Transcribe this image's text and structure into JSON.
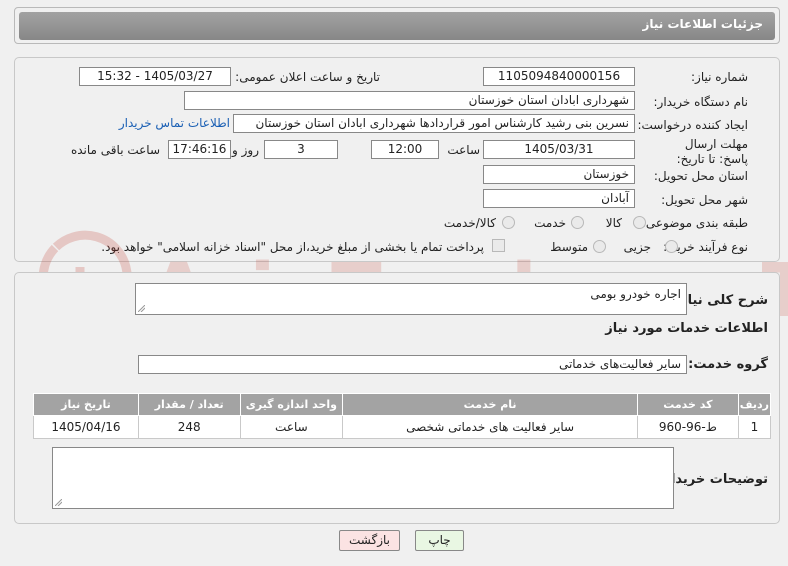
{
  "header": {
    "title": "جزئیات اطلاعات نیاز"
  },
  "form": {
    "need_number_label": "شماره نیاز:",
    "need_number": "1105094840000156",
    "announce_label": "تاریخ و ساعت اعلان عمومی:",
    "announce_value": "1405/03/27 - 15:32",
    "buyer_org_label": "نام دستگاه خریدار:",
    "buyer_org": "شهرداری ابادان استان خوزستان",
    "creator_label": "ایجاد کننده درخواست:",
    "creator": "نسرین بنی رشید کارشناس امور قراردادها شهرداری ابادان استان خوزستان",
    "contact_link": "اطلاعات تماس خریدار",
    "deadline_label": "مهلت ارسال پاسخ: تا تاریخ:",
    "deadline_date": "1405/03/31",
    "time_label": "ساعت",
    "deadline_time": "12:00",
    "days_value": "3",
    "days_label": "روز و",
    "remaining_time": "17:46:16",
    "remaining_label": "ساعت باقی مانده",
    "province_label": "استان محل تحویل:",
    "province": "خوزستان",
    "city_label": "شهر محل تحویل:",
    "city": "آبادان",
    "category_label": "طبقه بندی موضوعی:",
    "category_options": [
      "کالا",
      "خدمت",
      "کالا/خدمت"
    ],
    "purchase_label": "نوع فرآیند خرید :",
    "purchase_options": [
      "جزیی",
      "متوسط"
    ],
    "payment_note": "پرداخت تمام یا بخشی از مبلغ خرید،از محل \"اسناد خزانه اسلامی\" خواهد بود."
  },
  "description": {
    "label": "شرح کلی نیاز:",
    "value": "اجاره خودرو بومی"
  },
  "services": {
    "section_title": "اطلاعات خدمات مورد نیاز",
    "group_label": "گروه خدمت:",
    "group_value": "سایر فعالیت‌های خدماتی",
    "headers": [
      "ردیف",
      "کد خدمت",
      "نام خدمت",
      "واحد اندازه گیری",
      "تعداد / مقدار",
      "تاریخ نیاز"
    ],
    "rows": [
      [
        "1",
        "ط-96-960",
        "سایر فعالیت های خدماتی شخصی",
        "ساعت",
        "248",
        "1405/04/16"
      ]
    ]
  },
  "buyer_notes": {
    "label": "توضیحات خریدار:",
    "value": ""
  },
  "buttons": {
    "print": "چاپ",
    "back": "بازگشت"
  },
  "watermark": {
    "text": "AriaTender.neT"
  }
}
